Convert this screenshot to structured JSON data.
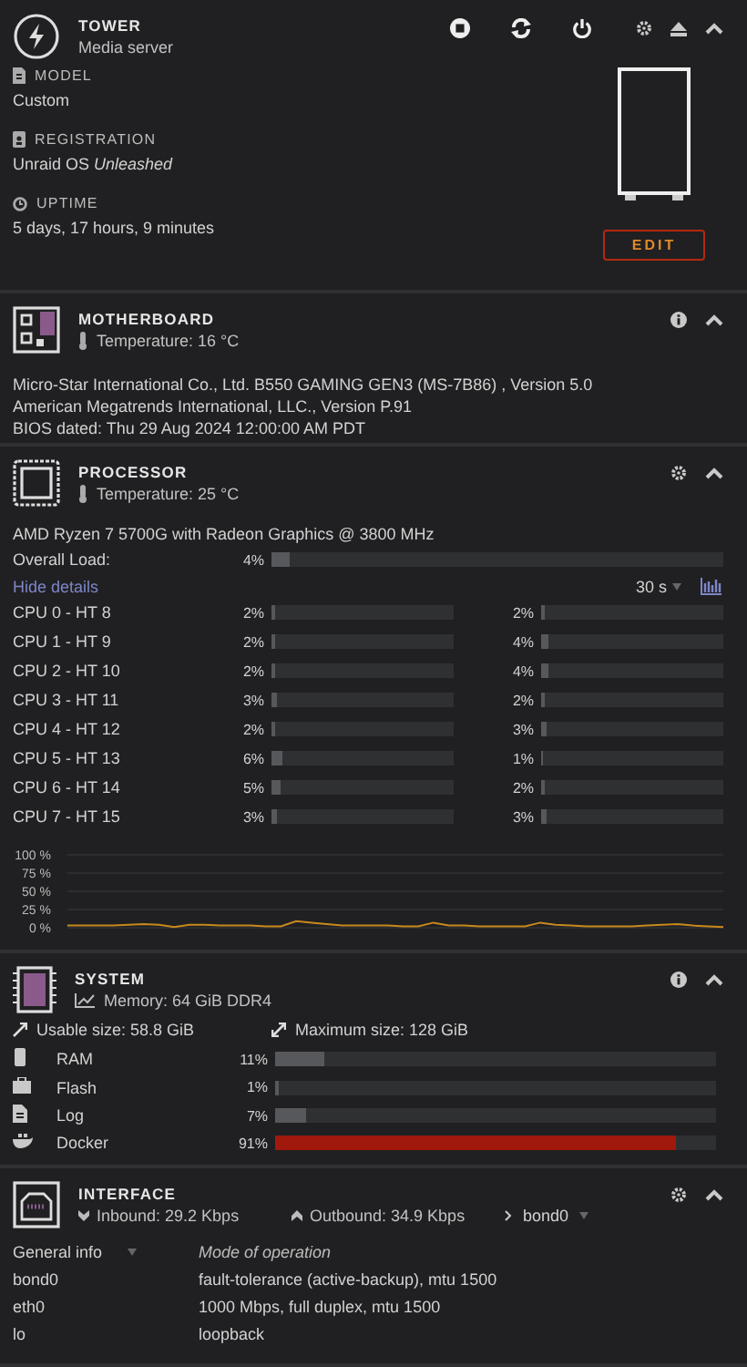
{
  "tower": {
    "title": "TOWER",
    "subtitle": "Media server",
    "info": [
      {
        "kind": "model",
        "label": "MODEL",
        "value": "Custom"
      },
      {
        "kind": "registration",
        "label": "REGISTRATION",
        "value": "Unraid OS *Unleashed*"
      },
      {
        "kind": "uptime",
        "label": "UPTIME",
        "value": "5 days, 17 hours, 9 minutes"
      }
    ],
    "edit_button": "EDIT"
  },
  "motherboard": {
    "title": "MOTHERBOARD",
    "temperature": "Temperature: 16 °C",
    "lines": [
      "Micro-Star International Co., Ltd. B550 GAMING GEN3 (MS-7B86) , Version 5.0",
      "American Megatrends International, LLC., Version P.91",
      "BIOS dated: Thu 29 Aug 2024 12:00:00 AM PDT"
    ]
  },
  "processor": {
    "title": "PROCESSOR",
    "temperature": "Temperature: 25 °C",
    "model": "AMD Ryzen 7 5700G with Radeon Graphics @ 3800 MHz",
    "overall": {
      "label": "Overall Load:",
      "reading": "4%",
      "level": 0.04
    },
    "details_link": "Hide details",
    "interval": "30 s",
    "cores": [
      {
        "name": "CPU 0 - HT 8",
        "threads": [
          {
            "reading": "2%",
            "level": 0.02
          },
          {
            "reading": "2%",
            "level": 0.02
          }
        ]
      },
      {
        "name": "CPU 1 - HT 9",
        "threads": [
          {
            "reading": "2%",
            "level": 0.02
          },
          {
            "reading": "4%",
            "level": 0.04
          }
        ]
      },
      {
        "name": "CPU 2 - HT 10",
        "threads": [
          {
            "reading": "2%",
            "level": 0.02
          },
          {
            "reading": "4%",
            "level": 0.04
          }
        ]
      },
      {
        "name": "CPU 3 - HT 11",
        "threads": [
          {
            "reading": "3%",
            "level": 0.03
          },
          {
            "reading": "2%",
            "level": 0.02
          }
        ]
      },
      {
        "name": "CPU 4 - HT 12",
        "threads": [
          {
            "reading": "2%",
            "level": 0.02
          },
          {
            "reading": "3%",
            "level": 0.03
          }
        ]
      },
      {
        "name": "CPU 5 - HT 13",
        "threads": [
          {
            "reading": "6%",
            "level": 0.06
          },
          {
            "reading": "1%",
            "level": 0.01
          }
        ]
      },
      {
        "name": "CPU 6 - HT 14",
        "threads": [
          {
            "reading": "5%",
            "level": 0.05
          },
          {
            "reading": "2%",
            "level": 0.02
          }
        ]
      },
      {
        "name": "CPU 7 - HT 15",
        "threads": [
          {
            "reading": "3%",
            "level": 0.03
          },
          {
            "reading": "3%",
            "level": 0.03
          }
        ]
      }
    ],
    "chart_data": {
      "type": "line",
      "grid": true,
      "ylim": [
        0,
        100
      ],
      "yticks": [
        {
          "value": 100,
          "label": "100 %"
        },
        {
          "value": 75,
          "label": "75 %"
        },
        {
          "value": 50,
          "label": "50 %"
        },
        {
          "value": 25,
          "label": "25 %"
        },
        {
          "value": 0,
          "label": "0 %"
        }
      ],
      "series": [
        {
          "color": "#c8891d",
          "values": [
            3,
            3,
            3,
            3,
            4,
            5,
            4,
            1,
            4,
            4,
            3,
            3,
            3,
            2,
            2,
            9,
            7,
            5,
            3,
            3,
            3,
            3,
            2,
            2,
            7,
            3,
            3,
            2,
            2,
            2,
            2,
            7,
            4,
            3,
            2,
            2,
            2,
            2,
            3,
            4,
            5,
            3,
            2,
            1
          ]
        }
      ]
    }
  },
  "system": {
    "title": "SYSTEM",
    "memory": "Memory: 64 GiB DDR4",
    "usable": "Usable size: 58.8 GiB",
    "maximum": "Maximum size: 128 GiB",
    "usage": [
      {
        "kind": "ram",
        "name": "RAM",
        "reading": "11%",
        "level": 0.11
      },
      {
        "kind": "flash",
        "name": "Flash",
        "reading": "1%",
        "level": 0.01
      },
      {
        "kind": "log",
        "name": "Log",
        "reading": "7%",
        "level": 0.07
      },
      {
        "kind": "docker",
        "name": "Docker",
        "reading": "91%",
        "level": 0.91
      }
    ]
  },
  "interface": {
    "title": "INTERFACE",
    "inbound": "Inbound: 29.2 Kbps",
    "outbound": "Outbound: 34.9 Kbps",
    "port": "bond0",
    "view": "General info",
    "column_2": "Mode of operation",
    "rows": [
      {
        "name": "bond0",
        "mode": "fault-tolerance (active-backup), mtu 1500"
      },
      {
        "name": "eth0",
        "mode": "1000 Mbps, full duplex, mtu 1500"
      },
      {
        "name": "lo",
        "mode": "loopback"
      }
    ]
  }
}
